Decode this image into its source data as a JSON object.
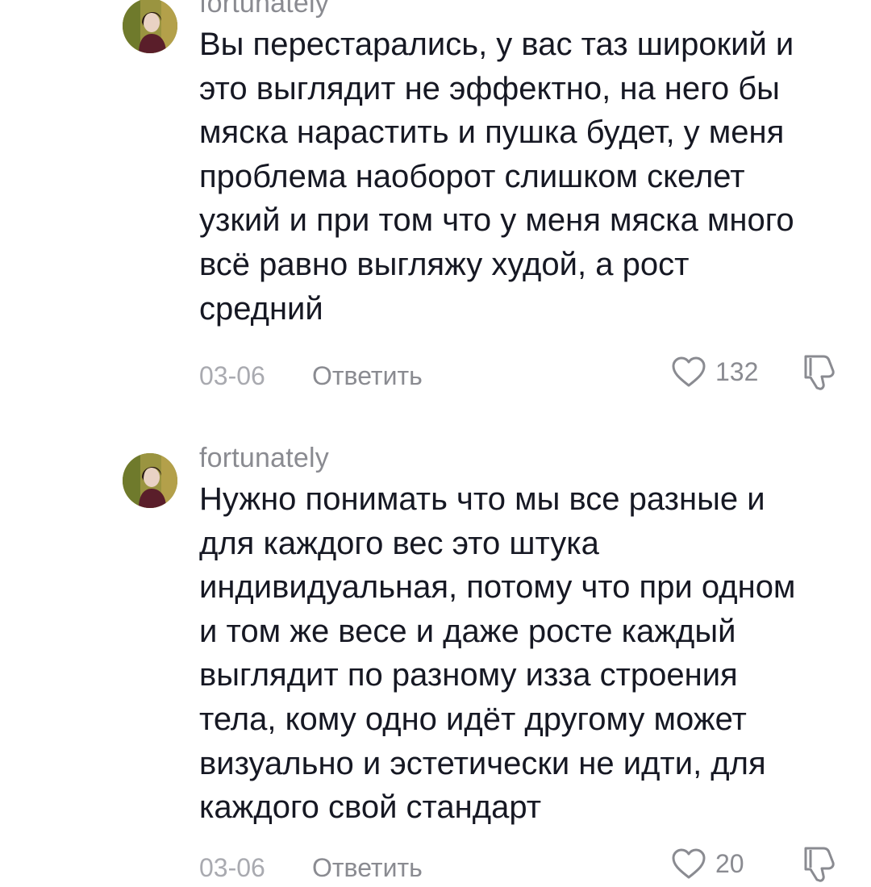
{
  "comments": [
    {
      "username": "fortunately",
      "text": "Вы перестарались, у вас таз широкий и\nэто выглядит не эффектно, на него бы\nмяска нарастить и пушка будет, у меня\nпроблема наоборот слишком скелет\nузкий и при том что у меня мяска много\nвсё равно выгляжу худой, а рост\nсредний",
      "date": "03-06",
      "reply_label": "Ответить",
      "like_count": "132",
      "avatar_icon": "user-avatar",
      "like_icon": "heart-outline-icon",
      "dislike_icon": "thumbs-down-outline-icon"
    },
    {
      "username": "fortunately",
      "text": "Нужно понимать что мы все разные и\nдля каждого вес это штука\nиндивидуальная, потому что при одном\nи том же весе и даже росте каждый\nвыглядит по разному изза строения\nтела, кому одно идёт другому может\nвизуально и эстетически не идти, для\nкаждого свой стандарт",
      "date": "03-06",
      "reply_label": "Ответить",
      "like_count": "20",
      "avatar_icon": "user-avatar",
      "like_icon": "heart-outline-icon",
      "dislike_icon": "thumbs-down-outline-icon"
    }
  ],
  "colors": {
    "text": "#161823",
    "secondary": "#8a8b91",
    "date": "#a9aab0"
  }
}
